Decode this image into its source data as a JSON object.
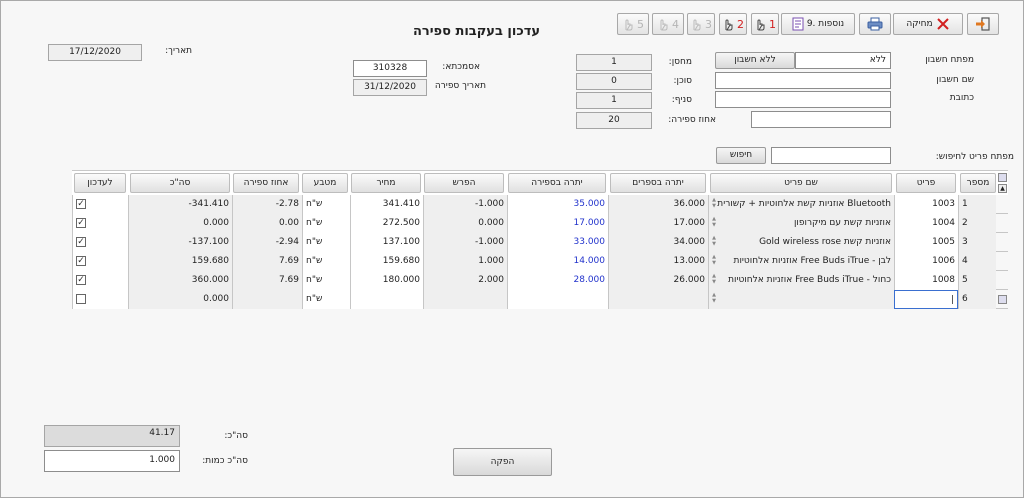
{
  "window": {
    "title": "עדכון בעקבות ספירה"
  },
  "toolbar": {
    "exit_icon": "exit-icon",
    "delete_label": "מחיקה",
    "print_icon": "printer-icon",
    "more_label": "9. נוספות",
    "steps": [
      "1",
      "2",
      "3",
      "4",
      "5"
    ]
  },
  "header": {
    "date_label": "תאריך:",
    "date_value": "17/12/2020",
    "reference_label": "אסמכתא:",
    "reference_value": "310328",
    "count_date_label": "תאריך ספירה",
    "count_date_value": "31/12/2020",
    "warehouse_label": "מחסן:",
    "warehouse_value": "1",
    "agent_label": "סוכן:",
    "agent_value": "0",
    "branch_label": "סניף:",
    "branch_value": "1",
    "count_percent_label": "אחוז ספירה:",
    "count_percent_value": "20",
    "account_key_label": "מפתח חשבון",
    "account_key_value": "ללא",
    "no_account_button": "ללא חשבון",
    "account_name_label": "שם חשבון",
    "account_name_value": "",
    "address_label": "כתובת",
    "address_value": "",
    "extra_value": "",
    "search_key_label": "מפתח פריט לחיפוש:",
    "search_value": "",
    "search_button": "חיפוש"
  },
  "grid": {
    "columns": [
      "מספר",
      "פריט",
      "שם פריט",
      "יתרה בספרים",
      "יתרה בספירה",
      "הפרש",
      "מחיר",
      "מטבע",
      "אחוז ספירה",
      "סה\"כ",
      "לעדכון"
    ],
    "rows": [
      {
        "num": "1",
        "item": "1003",
        "name": "אוזניות קשת אלחוטיות + קשורית Bluetooth",
        "book": "36.000",
        "counted": "35.000",
        "diff": "-1.000",
        "price": "341.410",
        "currency": "ש\"ח",
        "pct": "-2.78",
        "total": "-341.410",
        "update": true
      },
      {
        "num": "2",
        "item": "1004",
        "name": "אוזניות קשת עם מיקרופון",
        "book": "17.000",
        "counted": "17.000",
        "diff": "0.000",
        "price": "272.500",
        "currency": "ש\"ח",
        "pct": "0.00",
        "total": "0.000",
        "update": true
      },
      {
        "num": "3",
        "item": "1005",
        "name": "Gold wireless rose אוזניות קשת",
        "book": "34.000",
        "counted": "33.000",
        "diff": "-1.000",
        "price": "137.100",
        "currency": "ש\"ח",
        "pct": "-2.94",
        "total": "-137.100",
        "update": true
      },
      {
        "num": "4",
        "item": "1006",
        "name": "אוזניות אלחוטיות Free Buds iTrue - לבן",
        "book": "13.000",
        "counted": "14.000",
        "diff": "1.000",
        "price": "159.680",
        "currency": "ש\"ח",
        "pct": "7.69",
        "total": "159.680",
        "update": true
      },
      {
        "num": "5",
        "item": "1008",
        "name": "אוזניות אלחוטיות Free Buds iTrue - כחול",
        "book": "26.000",
        "counted": "28.000",
        "diff": "2.000",
        "price": "180.000",
        "currency": "ש\"ח",
        "pct": "7.69",
        "total": "360.000",
        "update": true
      },
      {
        "num": "6",
        "item": "",
        "name": "",
        "book": "",
        "counted": "",
        "diff": "",
        "price": "",
        "currency": "ש\"ח",
        "pct": "",
        "total": "0.000",
        "update": false
      }
    ]
  },
  "footer": {
    "total_label": "סה\"כ:",
    "total_value": "41.17",
    "qty_total_label": "סה\"כ כמות:",
    "qty_total_value": "1.000",
    "produce_button": "הפקה"
  },
  "colors": {
    "counted_text": "#2233cc",
    "delete_x": "#d22020",
    "exit_accent": "#e07820"
  }
}
